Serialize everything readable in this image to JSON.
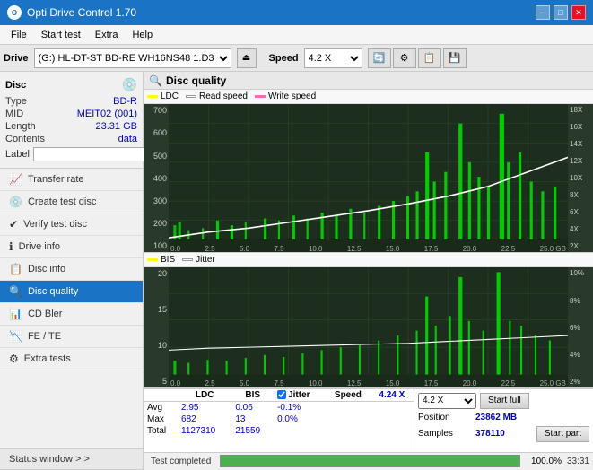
{
  "titlebar": {
    "title": "Opti Drive Control 1.70",
    "controls": [
      "minimize",
      "maximize",
      "close"
    ]
  },
  "menubar": {
    "items": [
      "File",
      "Start test",
      "Extra",
      "Help"
    ]
  },
  "drivebar": {
    "label": "Drive",
    "drive_value": "(G:) HL-DT-ST BD-RE  WH16NS48 1.D3",
    "speed_label": "Speed",
    "speed_value": "4.2 X"
  },
  "sidebar": {
    "disc_section": {
      "title": "Disc",
      "rows": [
        {
          "label": "Type",
          "value": "BD-R"
        },
        {
          "label": "MID",
          "value": "MEIT02 (001)"
        },
        {
          "label": "Length",
          "value": "23.31 GB"
        },
        {
          "label": "Contents",
          "value": "data"
        },
        {
          "label": "Label",
          "value": ""
        }
      ]
    },
    "nav_items": [
      {
        "label": "Transfer rate",
        "icon": "📈",
        "active": false
      },
      {
        "label": "Create test disc",
        "icon": "💿",
        "active": false
      },
      {
        "label": "Verify test disc",
        "icon": "✔",
        "active": false
      },
      {
        "label": "Drive info",
        "icon": "ℹ",
        "active": false
      },
      {
        "label": "Disc info",
        "icon": "📋",
        "active": false
      },
      {
        "label": "Disc quality",
        "icon": "🔍",
        "active": true
      },
      {
        "label": "CD Bler",
        "icon": "📊",
        "active": false
      },
      {
        "label": "FE / TE",
        "icon": "📉",
        "active": false
      },
      {
        "label": "Extra tests",
        "icon": "⚙",
        "active": false
      }
    ],
    "status_window": "Status window > >"
  },
  "content": {
    "title": "Disc quality",
    "chart1": {
      "legend": [
        {
          "label": "LDC",
          "color": "#ffff00"
        },
        {
          "label": "Read speed",
          "color": "#ffffff"
        },
        {
          "label": "Write speed",
          "color": "#ff69b4"
        }
      ],
      "y_max": 700,
      "y_right_labels": [
        "18X",
        "16X",
        "14X",
        "12X",
        "10X",
        "8X",
        "6X",
        "4X",
        "2X"
      ],
      "x_labels": [
        "0.0",
        "2.5",
        "5.0",
        "7.5",
        "10.0",
        "12.5",
        "15.0",
        "17.5",
        "20.0",
        "22.5",
        "25.0 GB"
      ]
    },
    "chart2": {
      "legend": [
        {
          "label": "BIS",
          "color": "#ffff00"
        },
        {
          "label": "Jitter",
          "color": "#ffffff"
        }
      ],
      "y_max": 20,
      "y_right_labels": [
        "10%",
        "8%",
        "6%",
        "4%",
        "2%"
      ],
      "x_labels": [
        "0.0",
        "2.5",
        "5.0",
        "7.5",
        "10.0",
        "12.5",
        "15.0",
        "17.5",
        "20.0",
        "22.5",
        "25.0 GB"
      ]
    },
    "stats": {
      "columns": [
        "",
        "LDC",
        "BIS",
        "",
        "Jitter",
        "Speed",
        "4.24 X"
      ],
      "rows": [
        {
          "label": "Avg",
          "ldc": "2.95",
          "bis": "0.06",
          "jitter": "-0.1%"
        },
        {
          "label": "Max",
          "ldc": "682",
          "bis": "13",
          "jitter": "0.0%"
        },
        {
          "label": "Total",
          "ldc": "1127310",
          "bis": "21559",
          "jitter": ""
        }
      ],
      "jitter_checked": true,
      "speed_value": "4.2 X",
      "position_label": "Position",
      "position_value": "23862 MB",
      "samples_label": "Samples",
      "samples_value": "378110",
      "start_full_label": "Start full",
      "start_part_label": "Start part"
    }
  },
  "progressbar": {
    "percent": 100,
    "percent_text": "100.0%",
    "time": "33:31",
    "status_text": "Test completed"
  }
}
